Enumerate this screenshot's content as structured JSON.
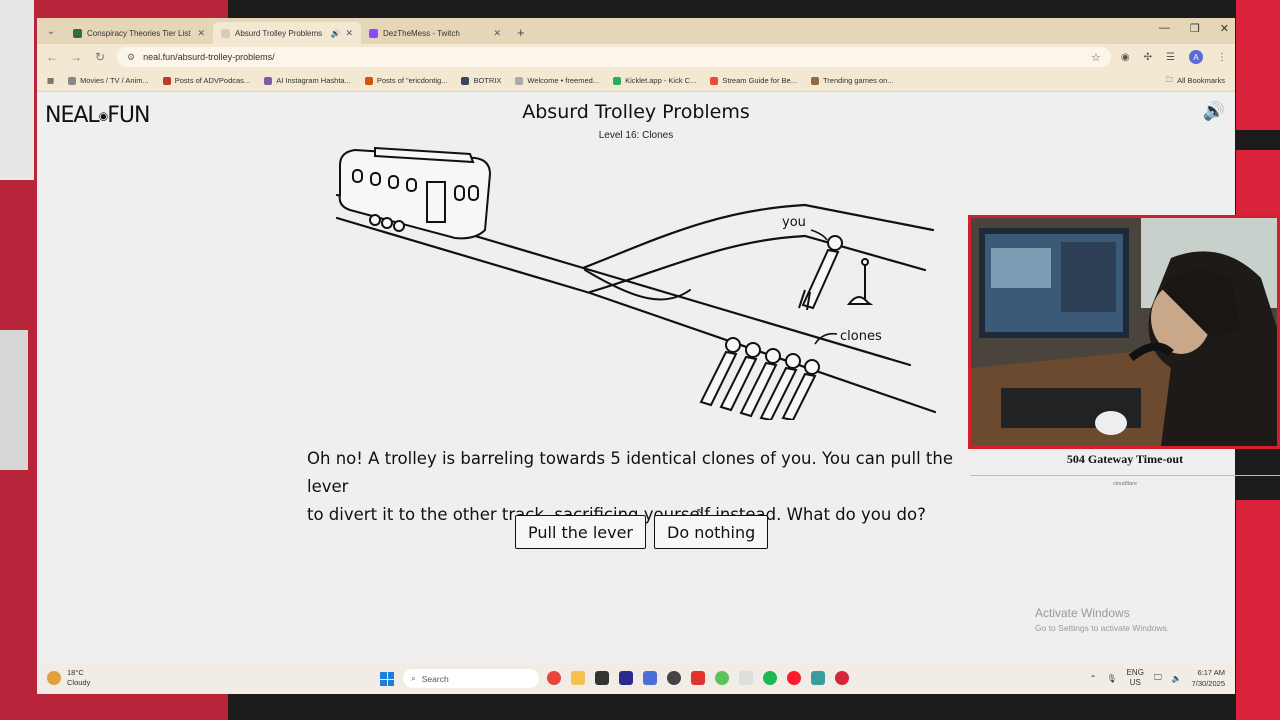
{
  "browser": {
    "tabs": [
      {
        "title": "Conspiracy Theories Tier List (C",
        "active": false,
        "favicon_color": "#2f6e3a"
      },
      {
        "title": "Absurd Trolley Problems",
        "active": true,
        "favicon_color": "#d9cdb4",
        "audio": true
      },
      {
        "title": "DezTheMess - Twitch",
        "active": false,
        "favicon_color": "#9146ff"
      }
    ],
    "url": "neal.fun/absurd-trolley-problems/",
    "profile_initial": "A",
    "bookmarks": [
      {
        "label": "Movies / TV / Anim...",
        "color": "#888888"
      },
      {
        "label": "Posts of ADVPodcas...",
        "color": "#c0392b"
      },
      {
        "label": "AI Instagram Hashta...",
        "color": "#7d5ba6"
      },
      {
        "label": "Posts of \"ericdontig...",
        "color": "#d35400"
      },
      {
        "label": "BOTRIX",
        "color": "#34495e"
      },
      {
        "label": "Welcome • freemed...",
        "color": "#aaaaaa"
      },
      {
        "label": "Kicklet.app - Kick C...",
        "color": "#27ae60"
      },
      {
        "label": "Stream Guide for Be...",
        "color": "#e74c3c"
      },
      {
        "label": "Trending games on...",
        "color": "#8e6b3e"
      }
    ],
    "all_bookmarks": "All Bookmarks"
  },
  "page": {
    "logo_left": "NEAL",
    "logo_right": "FUN",
    "title": "Absurd Trolley Problems",
    "level": "Level 16: Clones",
    "labels": {
      "you": "you",
      "clones": "clones"
    },
    "question_line1": "Oh no! A trolley is barreling towards 5 identical clones of you. You can pull the lever",
    "question_line2": "to divert it to the other track, sacrificing yourself instead. What do you do?",
    "btn_pull": "Pull the lever",
    "btn_nothing": "Do nothing"
  },
  "activate": {
    "title": "Activate Windows",
    "subtitle": "Go to Settings to activate Windows."
  },
  "overlay": {
    "error_title": "504 Gateway Time-out",
    "error_footer": "cloudflare"
  },
  "taskbar": {
    "temp": "18°C",
    "condition": "Cloudy",
    "search_placeholder": "Search",
    "lang": "ENG",
    "region": "US",
    "time": "6:17 AM",
    "date": "7/30/2025",
    "apps": [
      "#e8453c",
      "#f2c14e",
      "#333333",
      "#2b2b8f",
      "#4a6fd8",
      "#444444",
      "#e2342f",
      "#5cc35c",
      "#dddddd",
      "#1db954",
      "#ff1b2d",
      "#3b9c9c",
      "#d6243a"
    ]
  }
}
